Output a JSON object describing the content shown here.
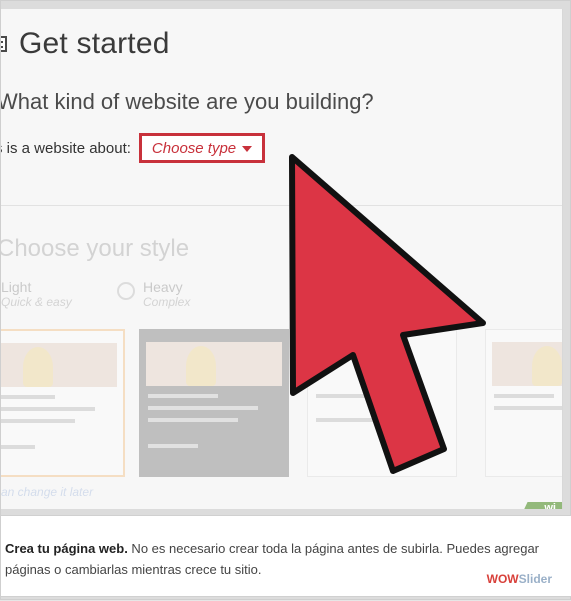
{
  "header": {
    "title": "Get started",
    "question": "What kind of website are you building?"
  },
  "about": {
    "label": "s is a website about:",
    "button": "Choose type"
  },
  "style": {
    "title": "Choose your style",
    "options": [
      {
        "name": "Light",
        "subtitle": "Quick & easy"
      },
      {
        "name": "Heavy",
        "subtitle": "Complex"
      }
    ],
    "note": "can change it later"
  },
  "badge": "wi",
  "caption": {
    "bold": "Crea tu página web.",
    "text": " No es necesario crear toda la página antes de subirla. Puedes agregar páginas o cambiarlas mientras crece tu sitio."
  },
  "watermark": {
    "part1": "WOW",
    "part2": "Slider"
  },
  "colors": {
    "accent": "#c8313b",
    "arrow": "#dc3545"
  }
}
